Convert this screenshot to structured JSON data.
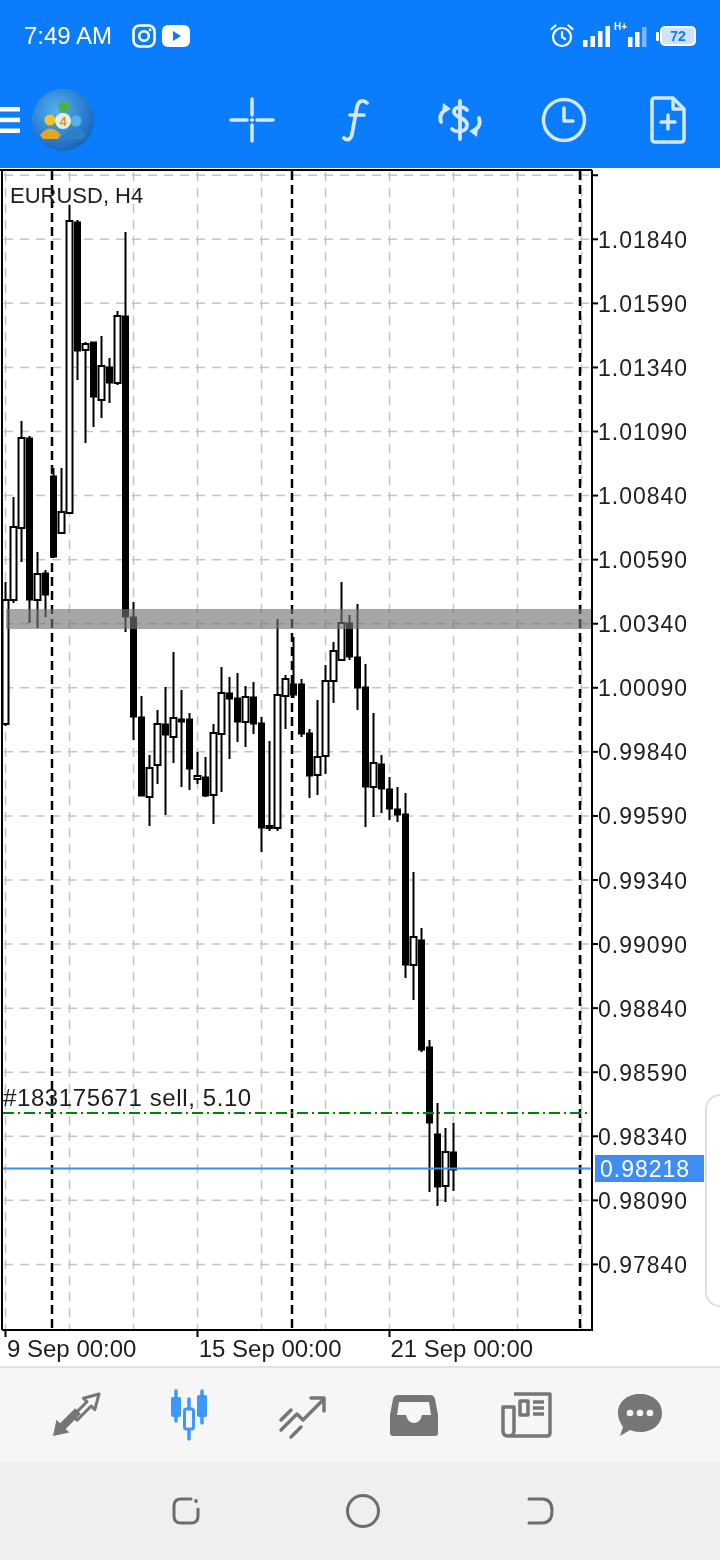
{
  "status_bar": {
    "time": "7:49 AM",
    "network_type": "H+",
    "battery": "72"
  },
  "toolbar": {
    "logo_badge": "4"
  },
  "chart": {
    "symbol": "EURUSD, H4",
    "price_ticks": [
      "1.01840",
      "1.01590",
      "1.01340",
      "1.01090",
      "1.00840",
      "1.00590",
      "1.00340",
      "1.00090",
      "0.99840",
      "0.99590",
      "0.99340",
      "0.99090",
      "0.98840",
      "0.98590",
      "0.98340",
      "0.98090",
      "0.97840"
    ],
    "order_label": "#183175671 sell, 5.10",
    "current_price": "0.98218",
    "time_ticks": [
      "9 Sep 00:00",
      "15 Sep 00:00",
      "21 Sep 00:00"
    ]
  },
  "bottom_nav": {
    "items": [
      {
        "kind": "arrows",
        "selected": false
      },
      {
        "kind": "candles",
        "selected": true
      },
      {
        "kind": "trend",
        "selected": false
      },
      {
        "kind": "tray",
        "selected": false
      },
      {
        "kind": "newspaper",
        "selected": false
      },
      {
        "kind": "chat",
        "selected": false
      }
    ]
  }
}
